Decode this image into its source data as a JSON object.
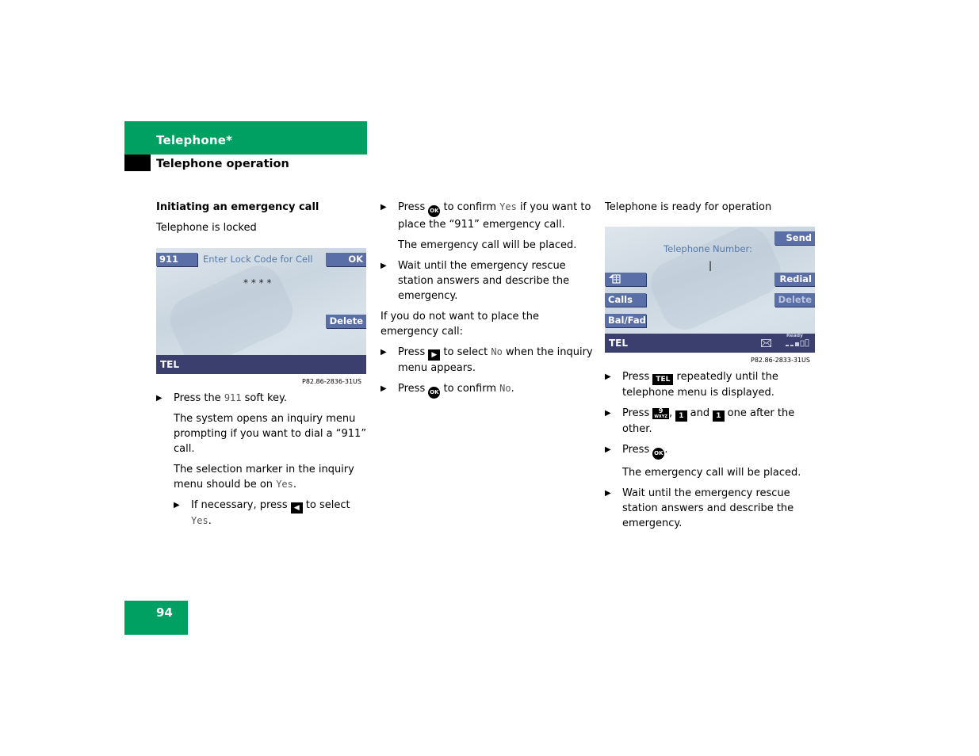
{
  "header": {
    "section": "Telephone*",
    "subsection": "Telephone operation"
  },
  "page_number": "94",
  "colors": {
    "brand_green": "#00a063",
    "softkey_blue": "#5a6fa8",
    "statusbar": "#3a3f6e",
    "screen_text": "#5579a8"
  },
  "col1": {
    "heading": "Initiating an emergency call",
    "intro": "Telephone is locked",
    "screen": {
      "softkey_911": "911",
      "prompt": "Enter Lock Code for Cell",
      "softkey_ok": "OK",
      "code_mask": "* * * *",
      "softkey_delete": "Delete",
      "status_label": "TEL",
      "caption": "P82.86-2836-31US"
    },
    "step1_pre": "Press the ",
    "step1_code": "911",
    "step1_post": " soft key.",
    "para1": "The system opens an inquiry menu prompting if you want to dial a “911” call.",
    "para2_pre": "The selection marker in the inquiry menu should be on ",
    "para2_code": "Yes",
    "para2_post": ".",
    "sub_step_pre": "If necessary, press ",
    "sub_step_key": "◀",
    "sub_step_mid": " to select ",
    "sub_step_code": "Yes",
    "sub_step_post": "."
  },
  "col2": {
    "step1_pre": "Press ",
    "ok_key": "OK",
    "step1_mid": " to confirm ",
    "step1_code": "Yes",
    "step1_post": " if you want to place the “911” emergency call.",
    "para1": "The emergency call will be placed.",
    "step2": "Wait until the emergency rescue station answers and describe the emergency.",
    "para2": "If you do not want to place the emergency call:",
    "step3_pre": "Press ",
    "step3_key": "▶",
    "step3_mid": " to select ",
    "step3_code": "No",
    "step3_post": " when the inquiry menu appears.",
    "step4_pre": "Press ",
    "step4_mid": " to confirm ",
    "step4_code": "No",
    "step4_post": "."
  },
  "col3": {
    "intro": "Telephone is ready for operation",
    "screen": {
      "softkey_send": "Send",
      "prompt": "Telephone Number:",
      "cursor": "|",
      "softkey_phonebook_icon": "phonebook-icon",
      "softkey_redial": "Redial",
      "softkey_calls": "Calls",
      "softkey_delete": "Delete",
      "softkey_balfad": "Bal/Fad",
      "status_label": "TEL",
      "status_ready": "Ready",
      "message_icon": "envelope-icon",
      "signal_icon": "signal-strength-icon",
      "caption": "P82.86-2833-31US"
    },
    "step1_pre": "Press ",
    "tel_key": "TEL",
    "step1_post": " repeatedly until the telephone menu is displayed.",
    "step2_pre": "Press ",
    "key_9": "9",
    "key_9_sub": "WXYZ",
    "step2_sep": ", ",
    "key_1": "1",
    "step2_and": " and ",
    "step2_post": " one after the other.",
    "step3_pre": "Press ",
    "step3_post": ".",
    "para1": "The emergency call will be placed.",
    "step4": "Wait until the emergency rescue station answers and describe the emergency."
  },
  "bullet_glyph": "▶"
}
